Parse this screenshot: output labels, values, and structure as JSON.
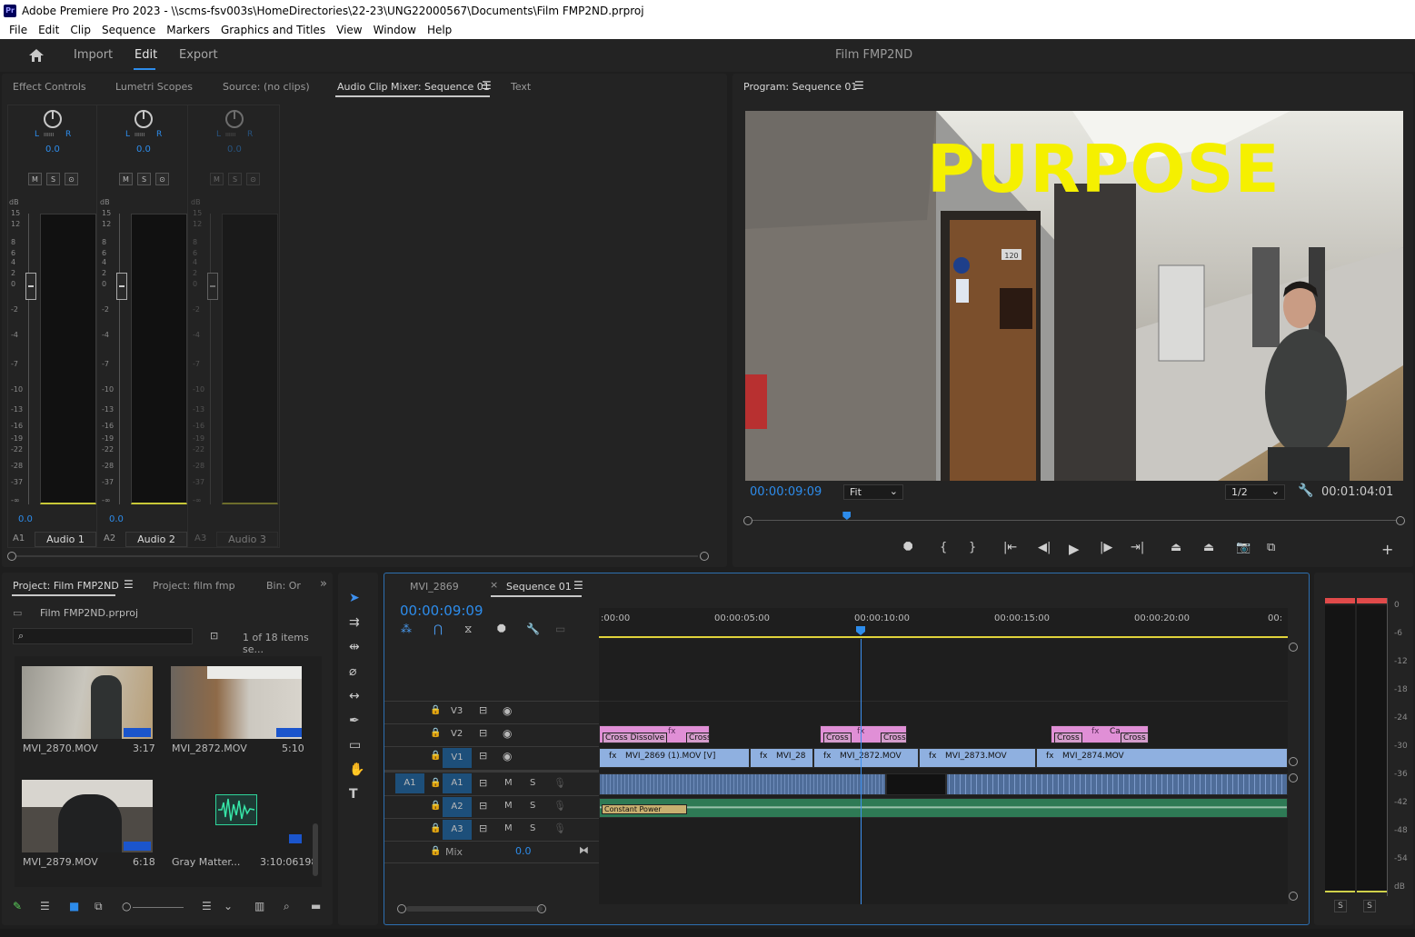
{
  "window": {
    "title": "Adobe Premiere Pro 2023 - \\\\scms-fsv003s\\HomeDirectories\\22-23\\UNG22000567\\Documents\\Film FMP2ND.prproj",
    "app_badge": "Pr"
  },
  "menu": [
    "File",
    "Edit",
    "Clip",
    "Sequence",
    "Markers",
    "Graphics and Titles",
    "View",
    "Window",
    "Help"
  ],
  "workspace": {
    "tabs": [
      "Import",
      "Edit",
      "Export"
    ],
    "active": "Edit",
    "project_name": "Film FMP2ND"
  },
  "source_panel": {
    "tabs": [
      "Effect Controls",
      "Lumetri Scopes",
      "Source: (no clips)",
      "Audio Clip Mixer: Sequence 01",
      "Text"
    ],
    "active_tab": "Audio Clip Mixer: Sequence 01",
    "db_scale": [
      "dB",
      "15",
      "12",
      "8",
      "6",
      "4",
      "2",
      "0",
      "-2",
      "-4",
      "-7",
      "-10",
      "-13",
      "-16",
      "-19",
      "-22",
      "-28",
      "-37",
      "-∞"
    ],
    "channels": [
      {
        "id": "A1",
        "name": "Audio 1",
        "pan": "0.0",
        "volume": "0.0",
        "lr": "L",
        "rr": "R",
        "buttons": [
          "M",
          "S",
          "⊙"
        ]
      },
      {
        "id": "A2",
        "name": "Audio 2",
        "pan": "0.0",
        "volume": "0.0",
        "lr": "L",
        "rr": "R",
        "buttons": [
          "M",
          "S",
          "⊙"
        ]
      },
      {
        "id": "A3",
        "name": "Audio 3",
        "pan": "0.0",
        "volume": "",
        "lr": "L",
        "rr": "R",
        "buttons": [
          "M",
          "S",
          "⊙"
        ]
      }
    ]
  },
  "program_monitor": {
    "title": "Program: Sequence 01",
    "overlay_text": "PURPOSE",
    "door_number": "120",
    "timecode": "00:00:09:09",
    "fit": "Fit",
    "resolution": "1/2",
    "duration": "00:01:04:01",
    "playhead_fraction": 0.146
  },
  "project_panel": {
    "tabs": [
      "Project: Film FMP2ND",
      "Project: film fmp",
      "Bin: Or"
    ],
    "file": "Film FMP2ND.prproj",
    "search_placeholder": "",
    "count": "1 of 18 items se...",
    "items": [
      {
        "name": "MVI_2870.MOV",
        "duration": "3:17"
      },
      {
        "name": "MVI_2872.MOV",
        "duration": "5:10"
      },
      {
        "name": "MVI_2879.MOV",
        "duration": "6:18"
      },
      {
        "name": "Gray Matter...",
        "duration": "3:10:06198"
      }
    ]
  },
  "tools": [
    "selection-tool",
    "track-select-tool",
    "ripple-edit-tool",
    "razor-tool",
    "slip-tool",
    "pen-tool",
    "rectangle-tool",
    "hand-tool",
    "type-tool"
  ],
  "timeline": {
    "tabs": [
      "MVI_2869",
      "Sequence 01"
    ],
    "active_tab": "Sequence 01",
    "timecode": "00:00:09:09",
    "ruler": [
      ":00:00",
      "00:00:05:00",
      "00:00:10:00",
      "00:00:15:00",
      "00:00:20:00",
      "00:"
    ],
    "tracks": {
      "video": [
        "V3",
        "V2",
        "V1"
      ],
      "audio": [
        {
          "source": "A1",
          "target": "A1",
          "m": "M",
          "s": "S"
        },
        {
          "source": "",
          "target": "A2",
          "m": "M",
          "s": "S"
        },
        {
          "source": "",
          "target": "A3",
          "m": "M",
          "s": "S"
        }
      ],
      "mix_label": "Mix",
      "mix_value": "0.0"
    },
    "v2_clips": [
      "Cross Dissolve",
      "Cross D",
      "Cross",
      "Cross D",
      "Cross",
      "Ca",
      "Cross D"
    ],
    "v1_clips": [
      "MVI_2869 (1).MOV [V]",
      "MVI_28",
      "MVI_2872.MOV",
      "MVI_2873.MOV",
      "MVI_2874.MOV"
    ],
    "a2_label": "Constant Power",
    "fx_label": "fx"
  },
  "audio_meter": {
    "scale": [
      "0",
      "-6",
      "-12",
      "-18",
      "-24",
      "-30",
      "-36",
      "-42",
      "-48",
      "-54",
      "dB"
    ],
    "solo": [
      "S",
      "S"
    ]
  },
  "colors": {
    "accent": "#2d8ceb",
    "panel": "#232323",
    "video_clip": "#8fb0e0",
    "transition": "#e08fd6",
    "audio_clip": "#4f6d99",
    "overlay_text": "#f5f000"
  }
}
